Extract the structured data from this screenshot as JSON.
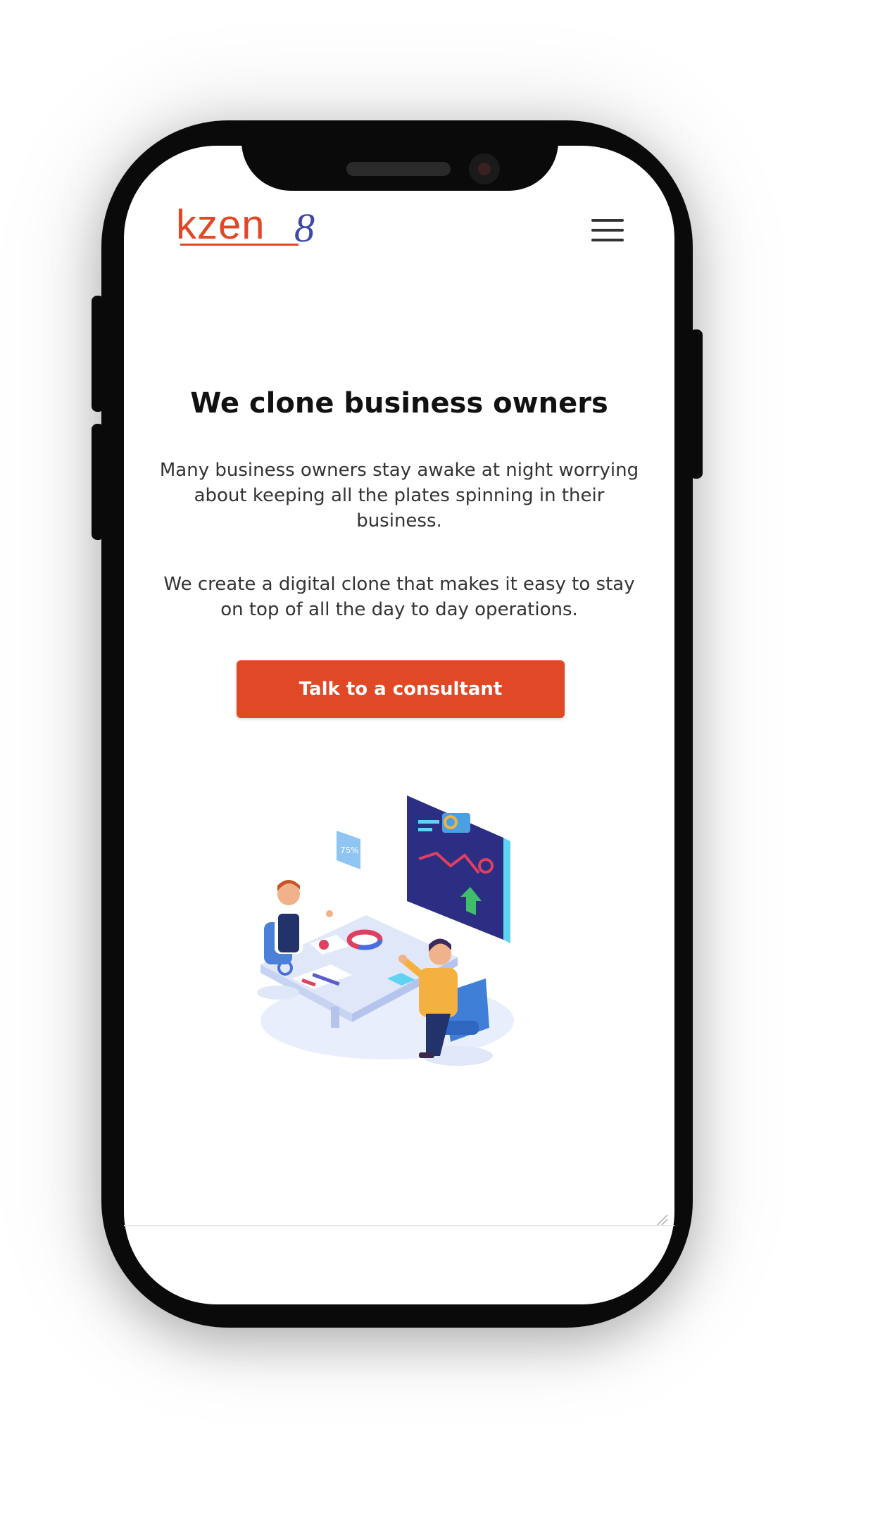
{
  "brand": {
    "logo_text": "kzen",
    "logo_suffix": "8",
    "accent_color": "#e04826",
    "secondary_color": "#3f4aa6"
  },
  "header": {
    "menu_icon": "hamburger-menu-icon"
  },
  "hero": {
    "title": "We clone business owners",
    "paragraph_1": "Many business owners stay awake at night worrying about keeping all the plates spinning in their business.",
    "paragraph_2": "We create a digital clone that makes it easy to stay on top of all the day to day operations.",
    "cta_label": "Talk to a consultant"
  },
  "illustration": {
    "badge_text": "75%"
  }
}
